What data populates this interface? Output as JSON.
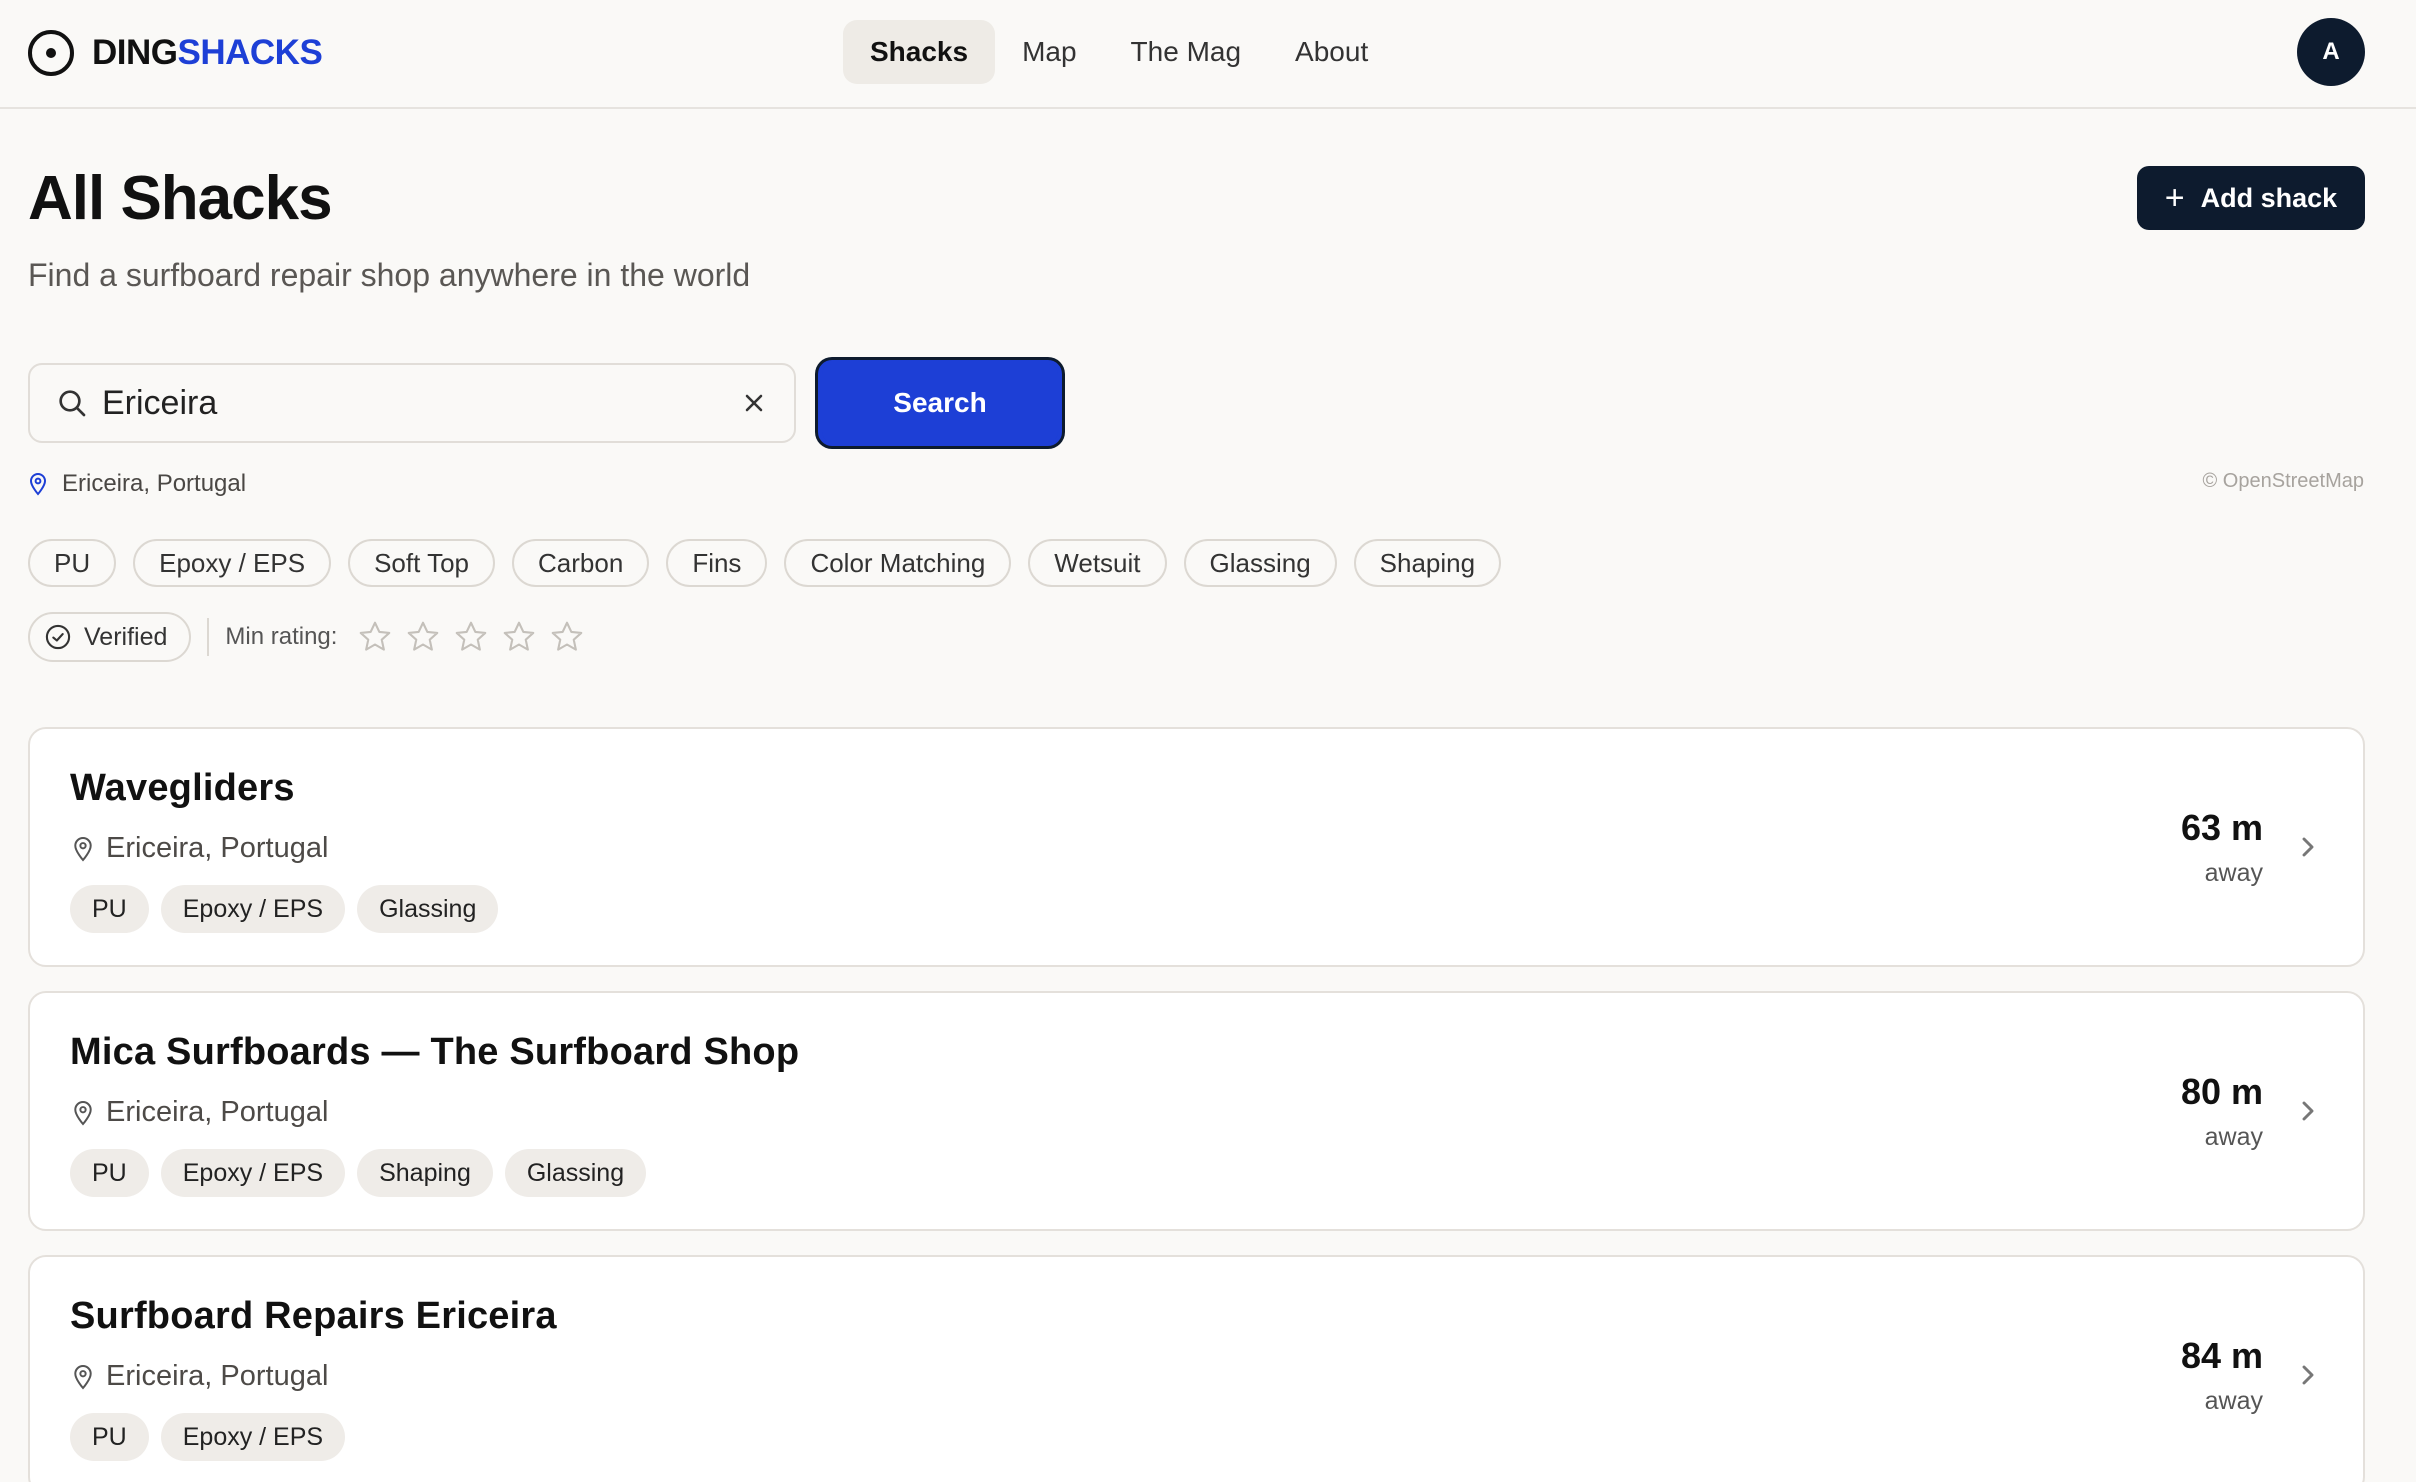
{
  "header": {
    "logo_part1": "DING",
    "logo_part2": "SHACKS",
    "nav": [
      "Shacks",
      "Map",
      "The Mag",
      "About"
    ],
    "active_nav": "Shacks",
    "avatar_initial": "A"
  },
  "page": {
    "title": "All Shacks",
    "subtitle": "Find a surfboard repair shop anywhere in the world",
    "add_button": "Add shack"
  },
  "search": {
    "value": "Ericeira",
    "button": "Search",
    "resolved_location": "Ericeira, Portugal",
    "attribution": "© OpenStreetMap"
  },
  "filters": {
    "chips": [
      "PU",
      "Epoxy / EPS",
      "Soft Top",
      "Carbon",
      "Fins",
      "Color Matching",
      "Wetsuit",
      "Glassing",
      "Shaping"
    ],
    "verified_label": "Verified",
    "min_rating_label": "Min rating:",
    "min_rating_value": 0,
    "max_stars": 5
  },
  "results": [
    {
      "name": "Wavegliders",
      "location": "Ericeira, Portugal",
      "tags": [
        "PU",
        "Epoxy / EPS",
        "Glassing"
      ],
      "distance": "63 m",
      "distance_suffix": "away"
    },
    {
      "name": "Mica Surfboards — The Surfboard Shop",
      "location": "Ericeira, Portugal",
      "tags": [
        "PU",
        "Epoxy / EPS",
        "Shaping",
        "Glassing"
      ],
      "distance": "80 m",
      "distance_suffix": "away"
    },
    {
      "name": "Surfboard Repairs Ericeira",
      "location": "Ericeira, Portugal",
      "tags": [
        "PU",
        "Epoxy / EPS"
      ],
      "distance": "84 m",
      "distance_suffix": "away"
    }
  ],
  "colors": {
    "accent": "#1d3fd6",
    "dark": "#0d1b2e",
    "background": "#faf9f7"
  },
  "icons": {
    "logo": "ring-dot-icon",
    "search": "search-icon",
    "clear": "close-icon",
    "location": "map-pin-icon",
    "verified": "check-circle-icon",
    "rating": "star-outline-icon",
    "card_arrow": "chevron-right-icon"
  }
}
